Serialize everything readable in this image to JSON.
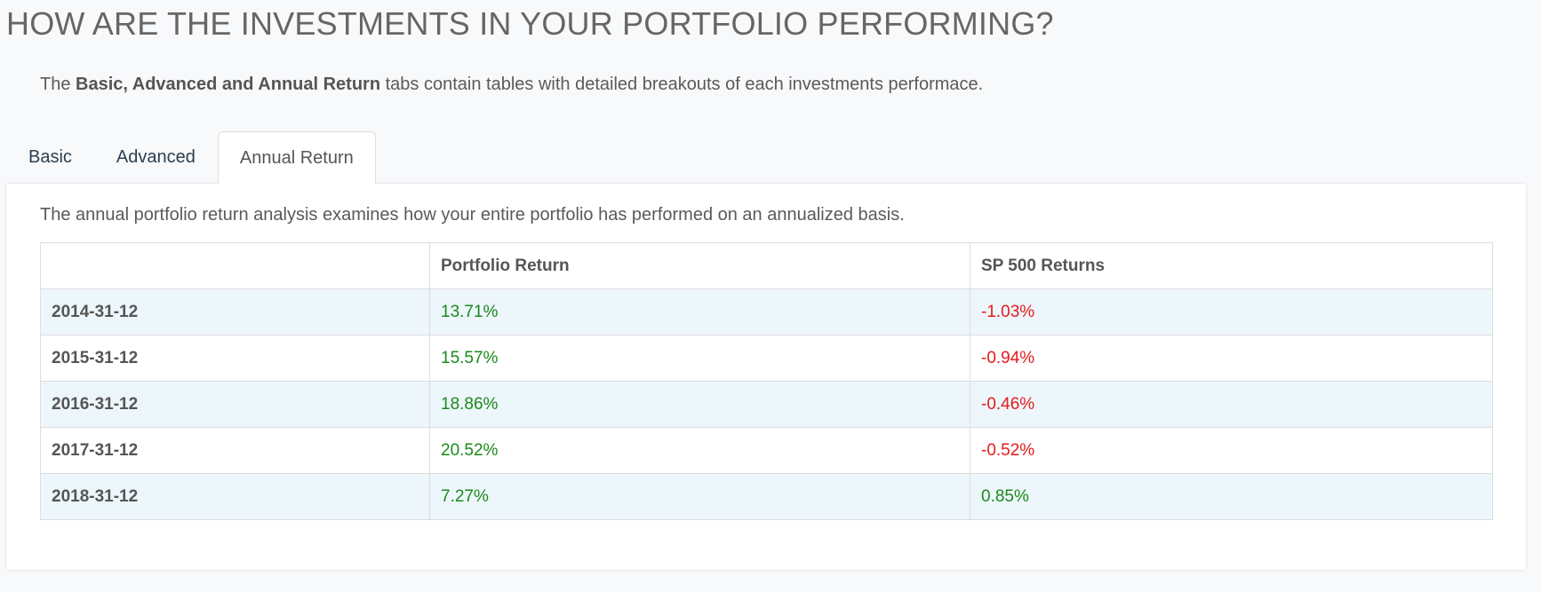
{
  "page": {
    "title": "HOW ARE THE INVESTMENTS IN YOUR PORTFOLIO PERFORMING?",
    "intro_prefix": "The ",
    "intro_bold": "Basic, Advanced and Annual Return",
    "intro_suffix": " tabs contain tables with detailed breakouts of each investments performace."
  },
  "tabs": [
    {
      "label": "Basic",
      "active": false
    },
    {
      "label": "Advanced",
      "active": false
    },
    {
      "label": "Annual Return",
      "active": true
    }
  ],
  "panel": {
    "description": "The annual portfolio return analysis examines how your entire portfolio has performed on an annualized basis.",
    "columns": [
      "",
      "Portfolio Return",
      "SP 500 Returns"
    ],
    "rows": [
      {
        "date": "2014-31-12",
        "portfolio": "13.71%",
        "sp500": "-1.03%"
      },
      {
        "date": "2015-31-12",
        "portfolio": "15.57%",
        "sp500": "-0.94%"
      },
      {
        "date": "2016-31-12",
        "portfolio": "18.86%",
        "sp500": "-0.46%"
      },
      {
        "date": "2017-31-12",
        "portfolio": "20.52%",
        "sp500": "-0.52%"
      },
      {
        "date": "2018-31-12",
        "portfolio": "7.27%",
        "sp500": "0.85%"
      }
    ]
  },
  "colors": {
    "positive": "#1a8a1a",
    "negative": "#e41a1a",
    "stripe": "#edf6fb"
  }
}
